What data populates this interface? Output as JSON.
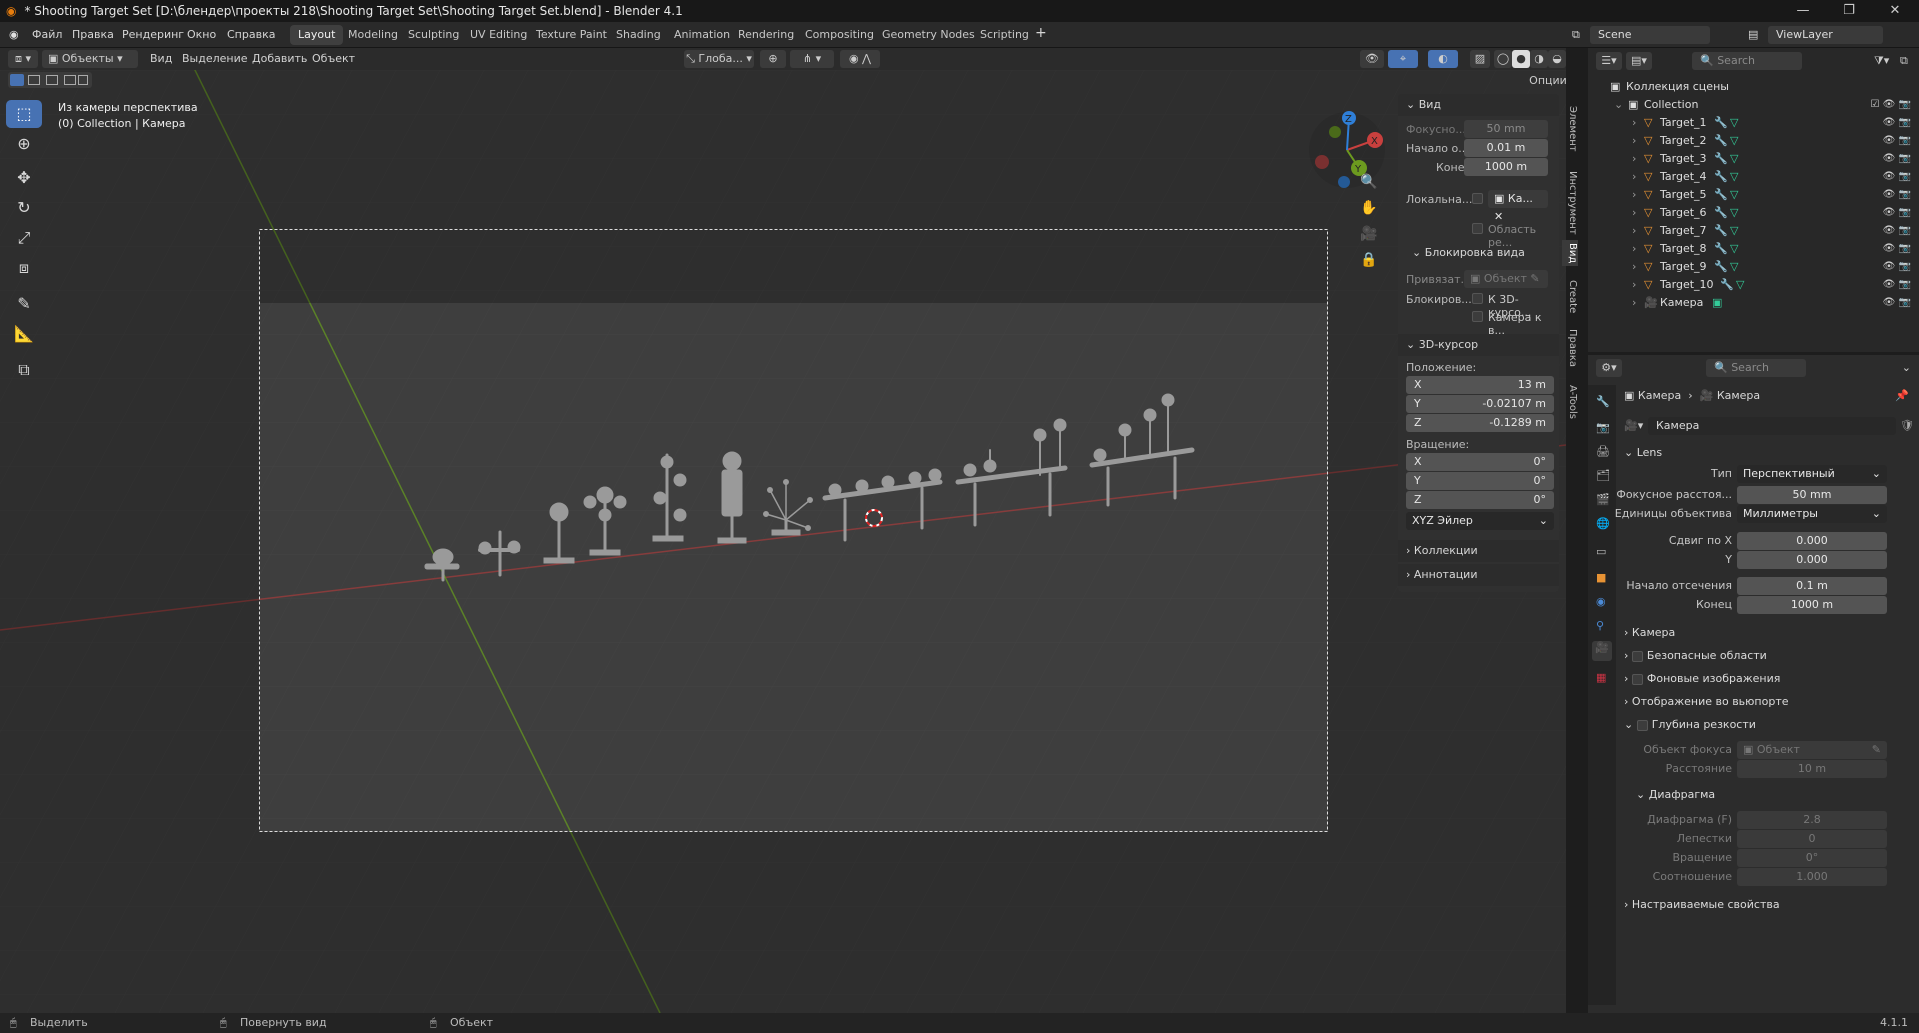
{
  "window": {
    "title": "* Shooting Target Set [D:\\блендер\\проекты 218\\Shooting Target Set\\Shooting Target Set.blend] - Blender 4.1"
  },
  "menu": [
    "Файл",
    "Правка",
    "Рендеринг",
    "Окно",
    "Справка"
  ],
  "workspaces": [
    "Layout",
    "Modeling",
    "Sculpting",
    "UV Editing",
    "Texture Paint",
    "Shading",
    "Animation",
    "Rendering",
    "Compositing",
    "Geometry Nodes",
    "Scripting"
  ],
  "scene": "Scene",
  "viewlayer": "ViewLayer",
  "viewport_header": {
    "mode": "Объекты",
    "items": [
      "Вид",
      "Выделение",
      "Добавить",
      "Объект"
    ],
    "orientation": "Глоба...",
    "options": "Опции"
  },
  "viewport": {
    "info_line1": "Из камеры перспектива",
    "info_line2": "(0) Collection | Камера"
  },
  "npanel": {
    "view_header": "Вид",
    "focal_label": "Фокусно...",
    "focal_value": "50 mm",
    "clip_start_label": "Начало о...",
    "clip_start_value": "0.01 m",
    "clip_end_label": "Конец",
    "clip_end_value": "1000 m",
    "local_label": "Локальна...",
    "local_value": "Ка...",
    "render_region": "Область ре...",
    "lock_header": "Блокировка вида",
    "lock_to_label": "Привязат...",
    "lock_to_value": "Объект",
    "lock_label": "Блокиров...",
    "lock_cursor": "К 3D-курсо...",
    "lock_camera": "Камера к в...",
    "cursor_header": "3D-курсор",
    "location_label": "Положение:",
    "loc_x": "13 m",
    "loc_y": "-0.02107 m",
    "loc_z": "-0.1289 m",
    "rotation_label": "Вращение:",
    "rot_x": "0°",
    "rot_y": "0°",
    "rot_z": "0°",
    "rot_mode": "XYZ Эйлер",
    "collections": "Коллекции",
    "annotations": "Аннотации"
  },
  "side_tabs": [
    "Элемент",
    "Инструмент",
    "Вид",
    "Create",
    "Правка",
    "A-Tools"
  ],
  "outliner": {
    "search_placeholder": "Search",
    "scene_collection": "Коллекция сцены",
    "collection": "Collection",
    "items": [
      "Target_1",
      "Target_2",
      "Target_3",
      "Target_4",
      "Target_5",
      "Target_6",
      "Target_7",
      "Target_8",
      "Target_9",
      "Target_10",
      "Камера"
    ]
  },
  "properties": {
    "search_placeholder": "Search",
    "breadcrumb1": "Камера",
    "breadcrumb2": "Камера",
    "datablock": "Камера",
    "lens_header": "Lens",
    "type_label": "Тип",
    "type_value": "Перспективный",
    "focal_label": "Фокусное расстоя...",
    "focal_value": "50 mm",
    "units_label": "Единицы объектива",
    "units_value": "Миллиметры",
    "shift_x_label": "Сдвиг по X",
    "shift_x_value": "0.000",
    "shift_y_label": "Y",
    "shift_y_value": "0.000",
    "clip_start_label": "Начало отсечения",
    "clip_start_value": "0.1 m",
    "clip_end_label": "Конец",
    "clip_end_value": "1000 m",
    "camera_header": "Камера",
    "safe_areas": "Безопасные области",
    "bg_images": "Фоновые изображения",
    "viewport_display": "Отображение во вьюпорте",
    "dof_header": "Глубина резкости",
    "focus_obj_label": "Объект фокуса",
    "focus_obj_value": "Объект",
    "distance_label": "Расстояние",
    "distance_value": "10 m",
    "aperture_header": "Диафрагма",
    "fstop_label": "Диафрагма (F)",
    "fstop_value": "2.8",
    "blades_label": "Лепестки",
    "blades_value": "0",
    "rotation_label": "Вращение",
    "rotation_value": "0°",
    "ratio_label": "Соотношение",
    "ratio_value": "1.000",
    "custom_props": "Настраиваемые свойства"
  },
  "statusbar": {
    "select": "Выделить",
    "rotate": "Повернуть вид",
    "object": "Объект",
    "version": "4.1.1"
  },
  "colors": {
    "accent": "#4772b3",
    "x_axis": "#c8403e",
    "y_axis": "#6c9a1f",
    "z_axis": "#2f7fd8"
  }
}
